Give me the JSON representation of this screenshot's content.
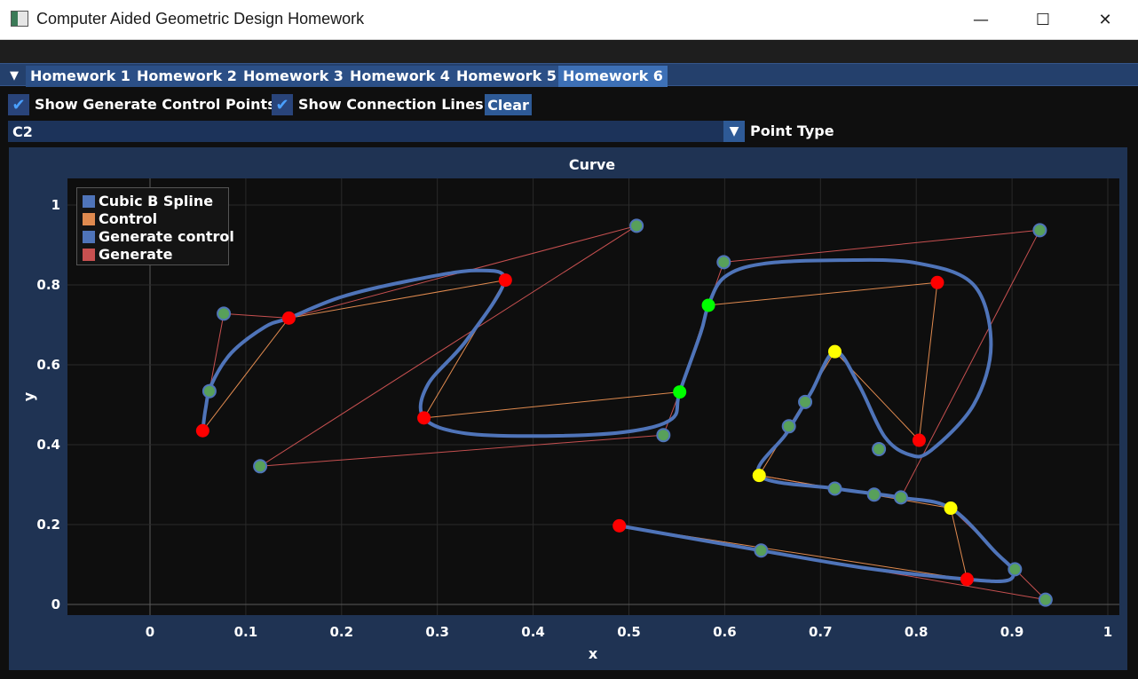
{
  "window": {
    "title": "Computer Aided Geometric Design Homework",
    "minimize": "—",
    "maximize": "☐",
    "close": "✕"
  },
  "menu": {
    "toggle_icon": "▼",
    "tabs": [
      "Homework 1",
      "Homework 2",
      "Homework 3",
      "Homework 4",
      "Homework 5",
      "Homework 6"
    ],
    "active_tab": "Homework 6"
  },
  "controls": {
    "show_generate_label": "Show Generate Control Points",
    "show_generate_checked": true,
    "show_lines_label": "Show Connection Lines",
    "show_lines_checked": true,
    "clear_label": "Clear",
    "point_type_value": "C2",
    "point_type_label": "Point Type",
    "check_glyph": "✔"
  },
  "colors": {
    "spline": "#4f74b9",
    "control_line": "#e08a4f",
    "generate_line": "#c75050",
    "generate_control": "#4f74b9",
    "point_green_center": "#58a05a",
    "point_red": "#ff0000",
    "point_green": "#00ff00",
    "point_yellow": "#ffff00"
  },
  "chart_data": {
    "type": "scatter",
    "title": "Curve",
    "xlabel": "x",
    "ylabel": "y",
    "xlim": [
      -0.09,
      1.01
    ],
    "ylim": [
      -0.03,
      1.06
    ],
    "xticks": [
      "0",
      "0.1",
      "0.2",
      "0.3",
      "0.4",
      "0.5",
      "0.6",
      "0.7",
      "0.8",
      "0.9",
      "1"
    ],
    "yticks": [
      "0",
      "0.2",
      "0.4",
      "0.6",
      "0.8",
      "1"
    ],
    "grid": true,
    "legend_position": "top-left",
    "legend": [
      {
        "name": "Cubic B Spline",
        "color": "#4f74b9"
      },
      {
        "name": "Control",
        "color": "#e08a4f"
      },
      {
        "name": "Generate control",
        "color": "#4f74b9"
      },
      {
        "name": "Generate",
        "color": "#c75050"
      }
    ],
    "control_points": [
      {
        "x": 0.055,
        "y": 0.435,
        "type": "red"
      },
      {
        "x": 0.145,
        "y": 0.717,
        "type": "red"
      },
      {
        "x": 0.371,
        "y": 0.812,
        "type": "red"
      },
      {
        "x": 0.286,
        "y": 0.467,
        "type": "red"
      },
      {
        "x": 0.553,
        "y": 0.532,
        "type": "green"
      },
      {
        "x": 0.583,
        "y": 0.749,
        "type": "green"
      },
      {
        "x": 0.822,
        "y": 0.806,
        "type": "red"
      },
      {
        "x": 0.803,
        "y": 0.411,
        "type": "red"
      },
      {
        "x": 0.715,
        "y": 0.633,
        "type": "yellow"
      },
      {
        "x": 0.636,
        "y": 0.323,
        "type": "yellow"
      },
      {
        "x": 0.836,
        "y": 0.241,
        "type": "yellow"
      },
      {
        "x": 0.853,
        "y": 0.063,
        "type": "red"
      },
      {
        "x": 0.49,
        "y": 0.197,
        "type": "red"
      }
    ],
    "generate_control_points": [
      {
        "x": 0.062,
        "y": 0.534
      },
      {
        "x": 0.077,
        "y": 0.728
      },
      {
        "x": 0.115,
        "y": 0.346
      },
      {
        "x": 0.508,
        "y": 0.948
      },
      {
        "x": 0.536,
        "y": 0.424
      },
      {
        "x": 0.599,
        "y": 0.857
      },
      {
        "x": 0.929,
        "y": 0.937
      },
      {
        "x": 0.761,
        "y": 0.389
      },
      {
        "x": 0.684,
        "y": 0.507
      },
      {
        "x": 0.667,
        "y": 0.446
      },
      {
        "x": 0.715,
        "y": 0.29
      },
      {
        "x": 0.756,
        "y": 0.275
      },
      {
        "x": 0.784,
        "y": 0.268
      },
      {
        "x": 0.903,
        "y": 0.088
      },
      {
        "x": 0.935,
        "y": 0.012
      },
      {
        "x": 0.638,
        "y": 0.135
      }
    ],
    "generate_polygon": [
      [
        0.055,
        0.435
      ],
      [
        0.062,
        0.534
      ],
      [
        0.077,
        0.728
      ],
      [
        0.145,
        0.717
      ],
      [
        0.508,
        0.948
      ],
      [
        0.115,
        0.346
      ],
      [
        0.536,
        0.424
      ],
      [
        0.553,
        0.532
      ],
      [
        0.583,
        0.749
      ],
      [
        0.599,
        0.857
      ],
      [
        0.929,
        0.937
      ],
      [
        0.784,
        0.268
      ],
      [
        0.756,
        0.275
      ],
      [
        0.715,
        0.29
      ],
      [
        0.636,
        0.323
      ]
    ],
    "generate_polygon_2": [
      [
        0.836,
        0.241
      ],
      [
        0.903,
        0.088
      ],
      [
        0.935,
        0.012
      ],
      [
        0.638,
        0.135
      ],
      [
        0.49,
        0.197
      ]
    ],
    "control_polygon": [
      [
        0.055,
        0.435
      ],
      [
        0.145,
        0.717
      ],
      [
        0.371,
        0.812
      ],
      [
        0.286,
        0.467
      ],
      [
        0.553,
        0.532
      ],
      [
        0.583,
        0.749
      ],
      [
        0.822,
        0.806
      ],
      [
        0.803,
        0.411
      ],
      [
        0.715,
        0.633
      ],
      [
        0.636,
        0.323
      ],
      [
        0.836,
        0.241
      ],
      [
        0.853,
        0.063
      ],
      [
        0.49,
        0.197
      ]
    ],
    "spline": [
      [
        0.055,
        0.435
      ],
      [
        0.058,
        0.49
      ],
      [
        0.064,
        0.55
      ],
      [
        0.085,
        0.63
      ],
      [
        0.12,
        0.695
      ],
      [
        0.145,
        0.717
      ],
      [
        0.2,
        0.77
      ],
      [
        0.27,
        0.81
      ],
      [
        0.34,
        0.836
      ],
      [
        0.37,
        0.81
      ],
      [
        0.33,
        0.66
      ],
      [
        0.29,
        0.55
      ],
      [
        0.286,
        0.467
      ],
      [
        0.33,
        0.428
      ],
      [
        0.42,
        0.422
      ],
      [
        0.5,
        0.433
      ],
      [
        0.545,
        0.465
      ],
      [
        0.553,
        0.532
      ],
      [
        0.575,
        0.68
      ],
      [
        0.583,
        0.749
      ],
      [
        0.6,
        0.82
      ],
      [
        0.64,
        0.853
      ],
      [
        0.72,
        0.862
      ],
      [
        0.8,
        0.855
      ],
      [
        0.86,
        0.8
      ],
      [
        0.878,
        0.65
      ],
      [
        0.86,
        0.5
      ],
      [
        0.815,
        0.385
      ],
      [
        0.793,
        0.375
      ],
      [
        0.767,
        0.42
      ],
      [
        0.74,
        0.55
      ],
      [
        0.715,
        0.633
      ],
      [
        0.69,
        0.53
      ],
      [
        0.665,
        0.43
      ],
      [
        0.636,
        0.323
      ],
      [
        0.716,
        0.29
      ],
      [
        0.783,
        0.268
      ],
      [
        0.836,
        0.241
      ],
      [
        0.883,
        0.13
      ],
      [
        0.9,
        0.088
      ],
      [
        0.895,
        0.06
      ],
      [
        0.853,
        0.063
      ],
      [
        0.75,
        0.09
      ],
      [
        0.638,
        0.135
      ],
      [
        0.49,
        0.197
      ]
    ]
  }
}
